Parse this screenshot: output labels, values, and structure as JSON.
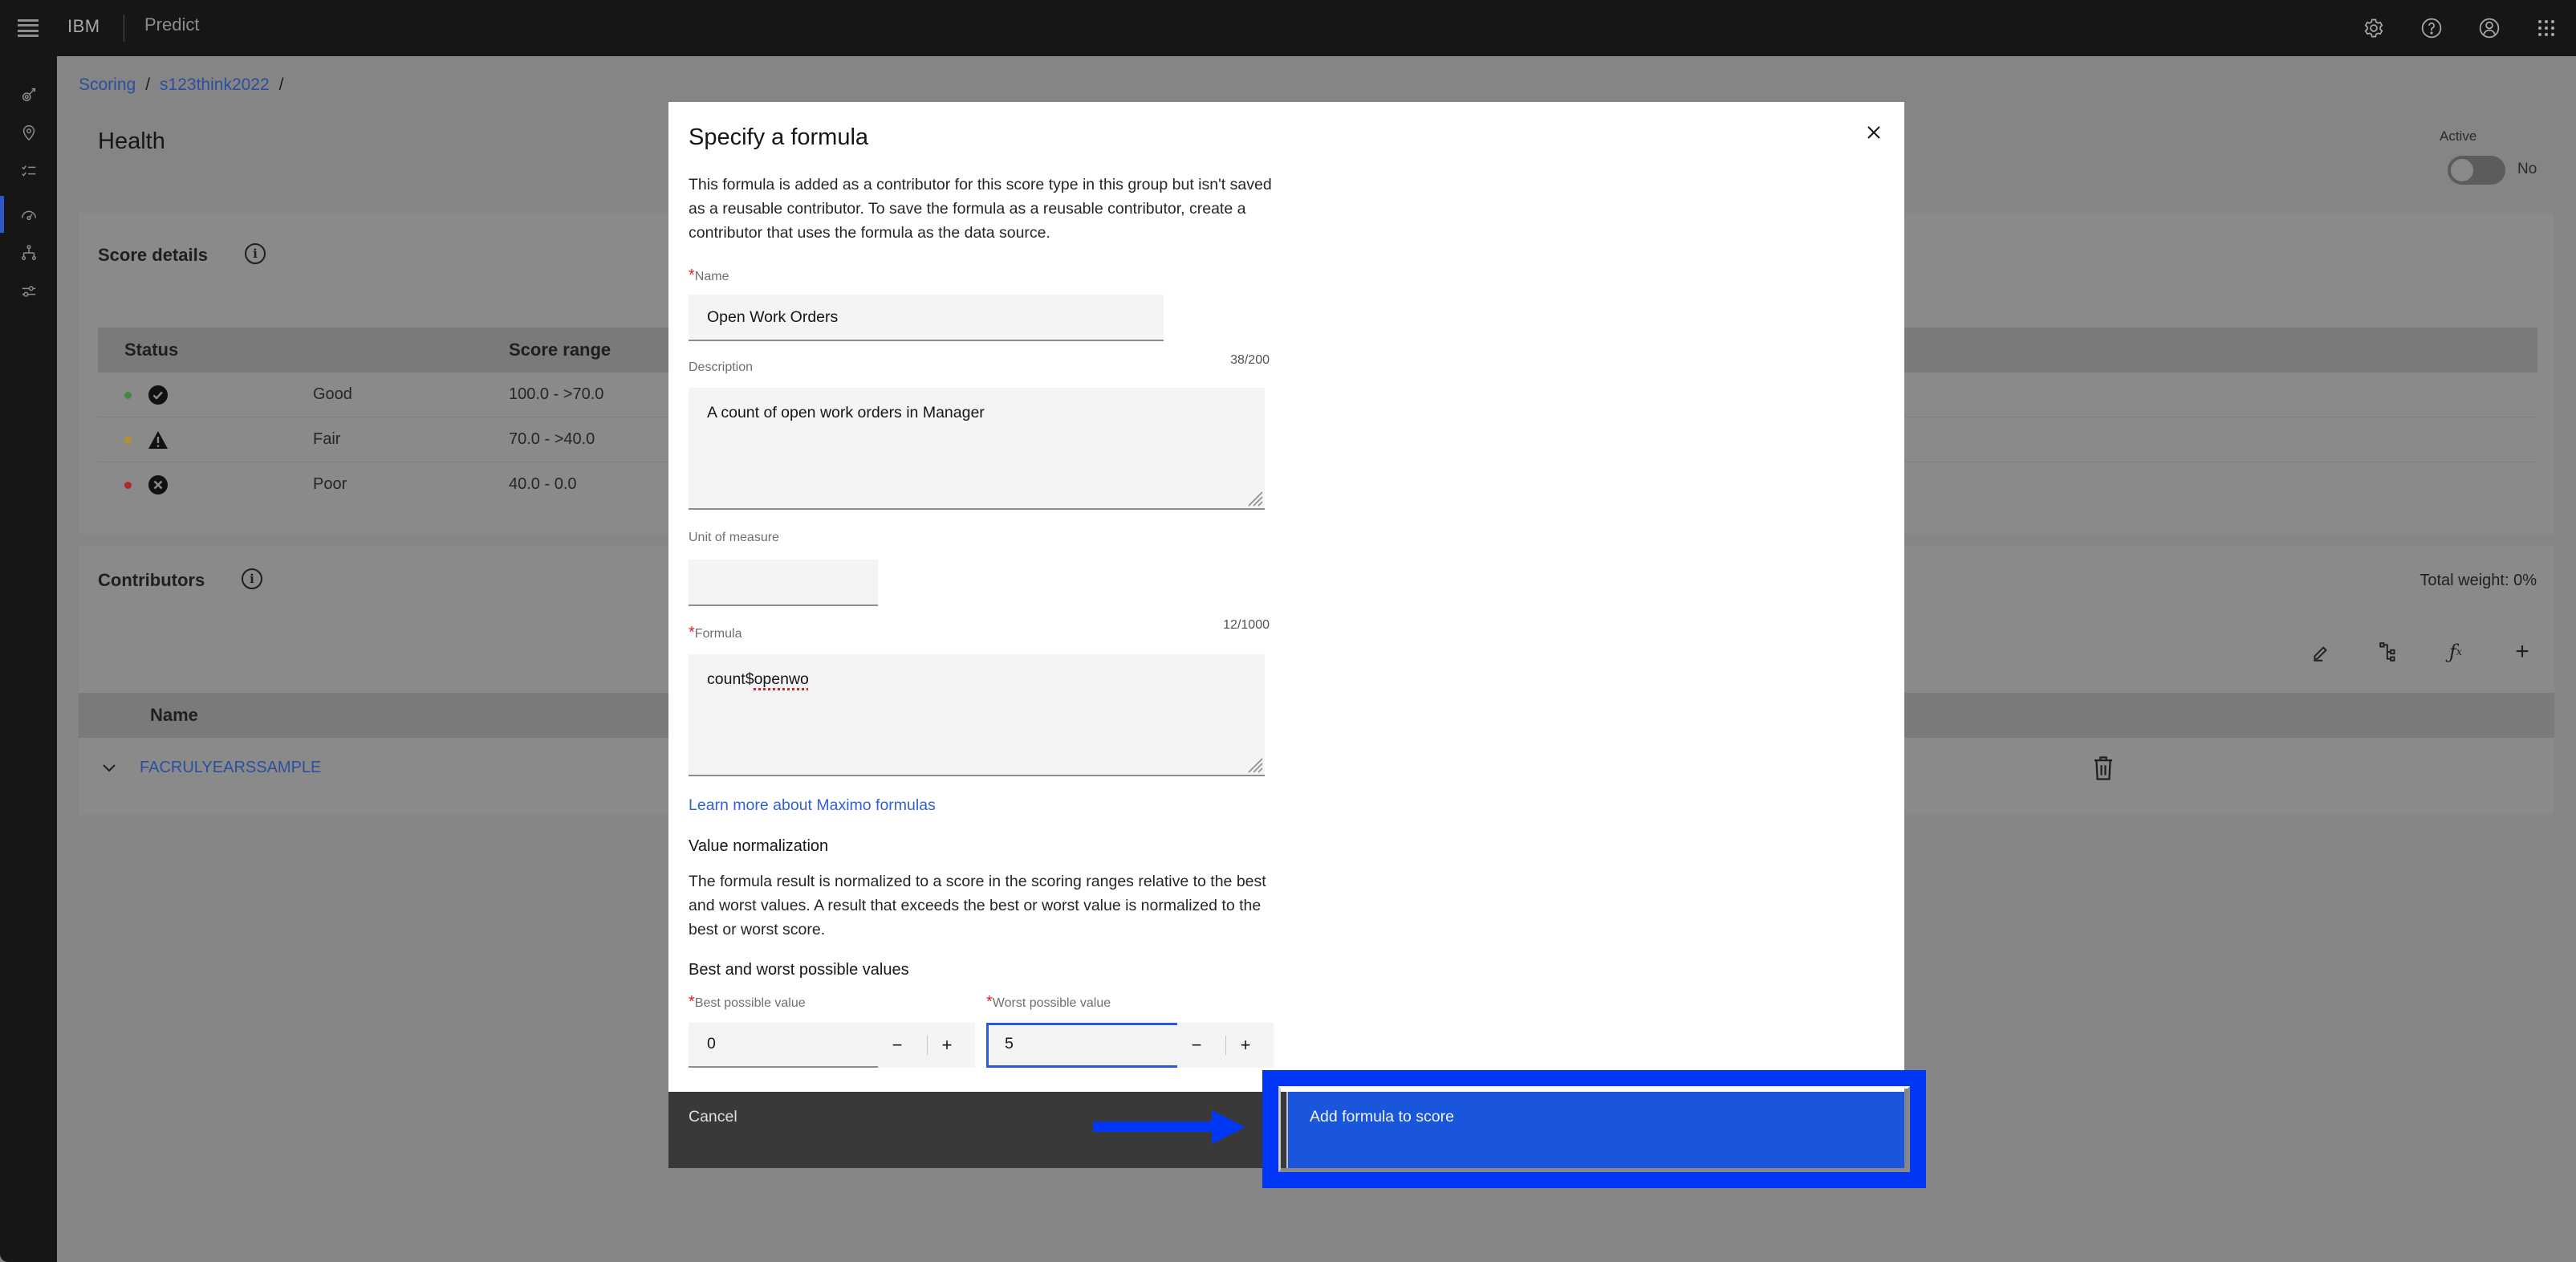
{
  "app": {
    "brand": "IBM",
    "product": "Predict"
  },
  "header_icons": [
    "settings-icon",
    "help-icon",
    "user-avatar-icon",
    "app-switcher-icon"
  ],
  "sidebar": {
    "items": [
      {
        "name": "assets",
        "icon": "gauge-rocket-icon",
        "active": false
      },
      {
        "name": "locations",
        "icon": "location-pin-icon",
        "active": false
      },
      {
        "name": "checklist",
        "icon": "checklist-icon",
        "active": false
      },
      {
        "name": "scoring",
        "icon": "speedometer-icon",
        "active": true
      },
      {
        "name": "hierarchy",
        "icon": "hierarchy-icon",
        "active": false
      },
      {
        "name": "settings-sliders",
        "icon": "sliders-icon",
        "active": false
      }
    ],
    "active_color": "#2e58c8"
  },
  "breadcrumb": {
    "items": [
      "Scoring",
      "s123think2022"
    ],
    "separator": "/"
  },
  "page": {
    "title": "Health",
    "active_label": "Active",
    "active_value": "No",
    "active_on": false
  },
  "score_details": {
    "title": "Score details",
    "columns": [
      "Status",
      "Score range"
    ],
    "rows": [
      {
        "status": "Good",
        "range": "100.0 - >70.0",
        "dot_color": "#3f8a3f",
        "icon": "checkmark-filled-icon"
      },
      {
        "status": "Fair",
        "range": "70.0 - >40.0",
        "dot_color": "#b8902a",
        "icon": "warning-triangle-icon"
      },
      {
        "status": "Poor",
        "range": "40.0 - 0.0",
        "dot_color": "#b02a2a",
        "icon": "error-filled-icon"
      }
    ]
  },
  "contributors": {
    "title": "Contributors",
    "total_weight": "Total weight: 0%",
    "toolbar": [
      "edit-icon",
      "tree-view-icon",
      "function-icon",
      "add-icon"
    ],
    "columns": [
      "Name"
    ],
    "rows": [
      {
        "name": "FACRULYEARSSAMPLE"
      }
    ]
  },
  "modal": {
    "title": "Specify a formula",
    "intro": "This formula is added as a contributor for this score type in this group but isn't saved as a reusable contributor. To save the formula as a reusable contributor, create a contributor that uses the formula as the data source.",
    "name": {
      "label": "Name",
      "required": true,
      "value": "Open Work Orders"
    },
    "description": {
      "label": "Description",
      "counter": "38/200",
      "value": "A count of open work orders in Manager"
    },
    "unit": {
      "label": "Unit of measure",
      "value": ""
    },
    "formula": {
      "label": "Formula",
      "required": true,
      "counter": "12/1000",
      "value_prefix": "count$",
      "value_misspelled": "openwo"
    },
    "learn_more": "Learn more about Maximo formulas",
    "normalization": {
      "heading": "Value normalization",
      "text": "The formula result is normalized to a score in the scoring ranges relative to the best and worst values. A result that exceeds the best or worst value is normalized to the best or worst score."
    },
    "best_worst": {
      "heading": "Best and worst possible values",
      "best": {
        "label": "Best possible value",
        "required": true,
        "value": "0"
      },
      "worst": {
        "label": "Worst possible value",
        "required": true,
        "value": "5"
      },
      "decrement": "−",
      "increment": "+"
    },
    "cancel_label": "Cancel",
    "primary_label": "Add formula to score",
    "primary_color": "#1a56db"
  },
  "annotation": {
    "highlight_color": "#0038f5",
    "target": "Add formula to score"
  }
}
